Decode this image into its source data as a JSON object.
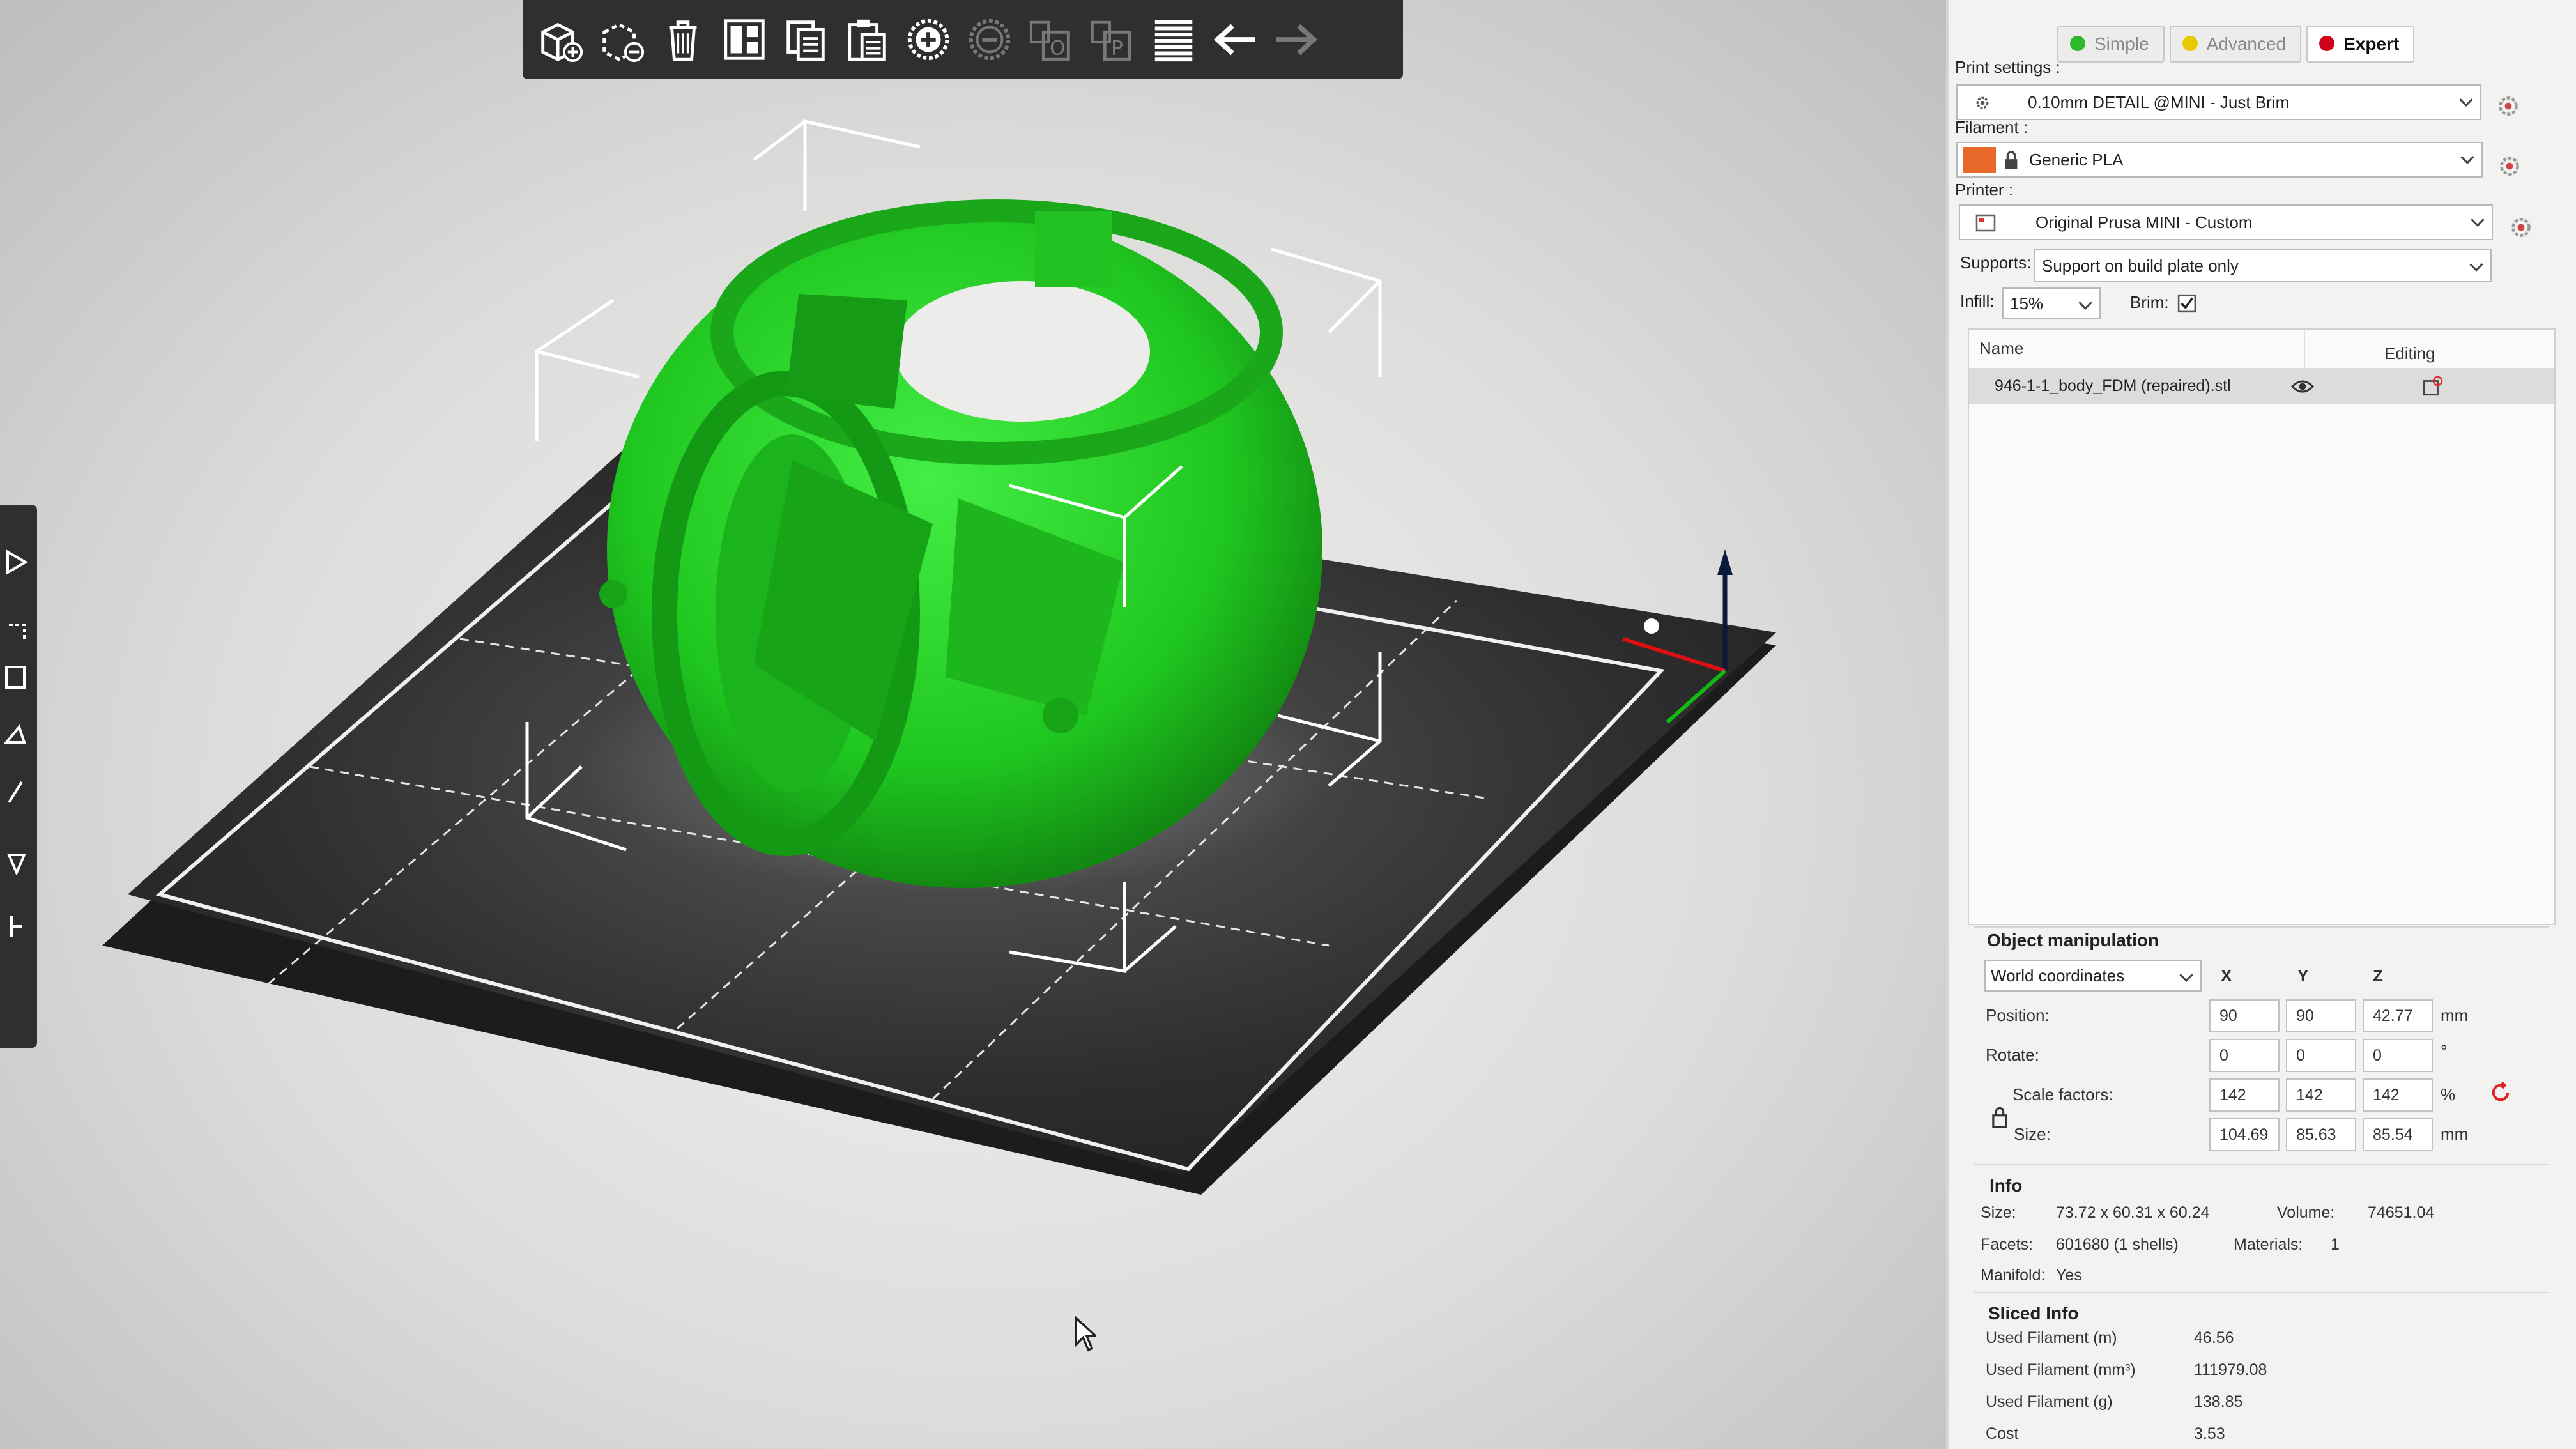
{
  "toolbar": {
    "buttons": [
      {
        "name": "add-icon"
      },
      {
        "name": "delete-icon"
      },
      {
        "name": "delete-all-icon"
      },
      {
        "name": "arrange-icon"
      },
      {
        "name": "copy-icon"
      },
      {
        "name": "paste-icon"
      },
      {
        "name": "add-instance-icon"
      },
      {
        "name": "remove-instance-icon"
      },
      {
        "name": "split-objects-icon"
      },
      {
        "name": "split-parts-icon"
      },
      {
        "name": "layers-editing-icon"
      },
      {
        "name": "undo-icon"
      },
      {
        "name": "redo-icon"
      }
    ]
  },
  "modes": {
    "simple": "Simple",
    "advanced": "Advanced",
    "expert": "Expert",
    "colors": {
      "simple": "#2db82d",
      "advanced": "#e8c800",
      "expert": "#d0021b"
    }
  },
  "print_settings": {
    "label": "Print settings :",
    "value": "0.10mm DETAIL @MINI - Just Brim"
  },
  "filament": {
    "label": "Filament :",
    "value": "Generic PLA",
    "color": "#e8692a"
  },
  "printer": {
    "label": "Printer :",
    "value": "Original Prusa MINI - Custom"
  },
  "supports": {
    "label": "Supports:",
    "value": "Support on build plate only"
  },
  "infill": {
    "label": "Infill:",
    "value": "15%"
  },
  "brim": {
    "label": "Brim:",
    "checked": true
  },
  "object_list": {
    "col_name": "Name",
    "col_editing": "Editing",
    "items": [
      {
        "name": "946-1-1_body_FDM (repaired).stl"
      }
    ]
  },
  "object_manipulation": {
    "title": "Object manipulation",
    "coord_system": "World coordinates",
    "axes": [
      "X",
      "Y",
      "Z"
    ],
    "position": {
      "label": "Position:",
      "x": "90",
      "y": "90",
      "z": "42.77",
      "unit": "mm"
    },
    "rotate": {
      "label": "Rotate:",
      "x": "0",
      "y": "0",
      "z": "0",
      "unit": "°"
    },
    "scale": {
      "label": "Scale factors:",
      "x": "142",
      "y": "142",
      "z": "142",
      "unit": "%"
    },
    "size": {
      "label": "Size:",
      "x": "104.69",
      "y": "85.63",
      "z": "85.54",
      "unit": "mm"
    }
  },
  "info": {
    "title": "Info",
    "size_label": "Size:",
    "size_value": "73.72 x 60.31 x 60.24",
    "volume_label": "Volume:",
    "volume_value": "74651.04",
    "facets_label": "Facets:",
    "facets_value": "601680 (1 shells)",
    "materials_label": "Materials:",
    "materials_value": "1",
    "manifold_label": "Manifold:",
    "manifold_value": "Yes"
  },
  "sliced_info": {
    "title": "Sliced Info",
    "rows": [
      {
        "label": "Used Filament (m)",
        "value": "46.56"
      },
      {
        "label": "Used Filament (mm³)",
        "value": "111979.08"
      },
      {
        "label": "Used Filament (g)",
        "value": "138.85"
      },
      {
        "label": "Cost",
        "value": "3.53"
      }
    ]
  },
  "scene": {
    "model_color": "#22cc22",
    "bed_color": "#2b2b2b"
  }
}
